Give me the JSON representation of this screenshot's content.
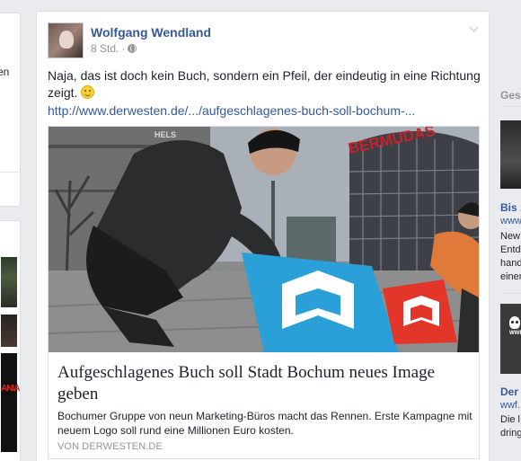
{
  "left": {
    "fragment": "en"
  },
  "post": {
    "author": "Wolfgang Wendland",
    "time": "8 Std.",
    "separator": "·",
    "privacy_icon": "globe-icon",
    "options_icon": "chevron-down-icon",
    "text": "Naja, das ist doch kein Buch, sondern ein Pfeil, der eindeutig in eine Richtung zeigt.",
    "emoji_icon": "smile-emoji-icon",
    "link": "http://www.derwesten.de/.../aufgeschlagenes-buch-soll-bochum-..."
  },
  "preview": {
    "image_sign_text": "BERMUDAS",
    "image_building_text": "HELS",
    "title": "Aufgeschlagenes Buch soll Stadt Bochum neues Image geben",
    "description": "Bochumer Gruppe von neun Marketing-Büros macht das Rennen. Erste Kampagne mit neuem Logo soll rund eine Millionen Euro kosten.",
    "source": "VON DERWESTEN.DE"
  },
  "right": {
    "heading": "Gesp",
    "item1_title": "Bis z",
    "item1_sub": "www",
    "item1_lines": [
      "New",
      "Entd",
      "hand",
      "einer"
    ],
    "item2_title": "Der l",
    "item2_sub": "wwf.",
    "item2_lines": [
      "Die l",
      "dring"
    ]
  },
  "colors": {
    "link": "#365899",
    "page_bg": "#e9ebee",
    "muted": "#90949c",
    "logo_blue": "#2a9fd8",
    "logo_red": "#e3362b"
  }
}
